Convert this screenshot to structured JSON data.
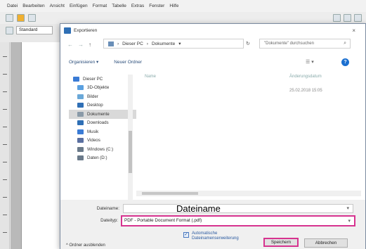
{
  "app": {
    "menu": [
      "Datei",
      "Bearbeiten",
      "Ansicht",
      "Einfügen",
      "Format",
      "Tabelle",
      "Extras",
      "Fenster",
      "Hilfe"
    ],
    "paragraph_style": "Standard"
  },
  "dialog": {
    "title": "Exportieren",
    "close_glyph": "×",
    "nav": {
      "back": "←",
      "forward": "→",
      "up": "↑"
    },
    "breadcrumb": [
      "Dieser PC",
      "Dokumente"
    ],
    "search_placeholder": "\"Dokumente\" durchsuchen",
    "toolbar": {
      "organize": "Organisieren ▾",
      "new_folder": "Neuer Ordner"
    },
    "nav_pane": [
      {
        "label": "Dieser PC",
        "color": "#3a7bd5"
      },
      {
        "label": "3D-Objekte",
        "color": "#5aa0e0"
      },
      {
        "label": "Bilder",
        "color": "#6aa8d8"
      },
      {
        "label": "Desktop",
        "color": "#2f6fb5"
      },
      {
        "label": "Dokumente",
        "color": "#8a9aa8",
        "selected": true
      },
      {
        "label": "Downloads",
        "color": "#2f6fb5"
      },
      {
        "label": "Musik",
        "color": "#3a7bd5"
      },
      {
        "label": "Videos",
        "color": "#5a6fa0"
      },
      {
        "label": "Windows (C:)",
        "color": "#6a7a8a"
      },
      {
        "label": "Daten (D:)",
        "color": "#6a7a8a"
      }
    ],
    "columns": {
      "name": "Name",
      "modified": "Änderungsdatum"
    },
    "file_date": "25.02.2018 15:05",
    "filename_label": "Dateiname:",
    "filename_value": "Dateiname",
    "filetype_label": "Dateityp:",
    "filetype_value": "PDF - Portable Document Format (.pdf)",
    "auto_ext_label": "Automatische Dateinamenserweiterung",
    "save_button": "Speichern",
    "cancel_button": "Abbrechen",
    "hide_folders": "Ordner ausblenden",
    "highlight_color": "#d6338f"
  }
}
